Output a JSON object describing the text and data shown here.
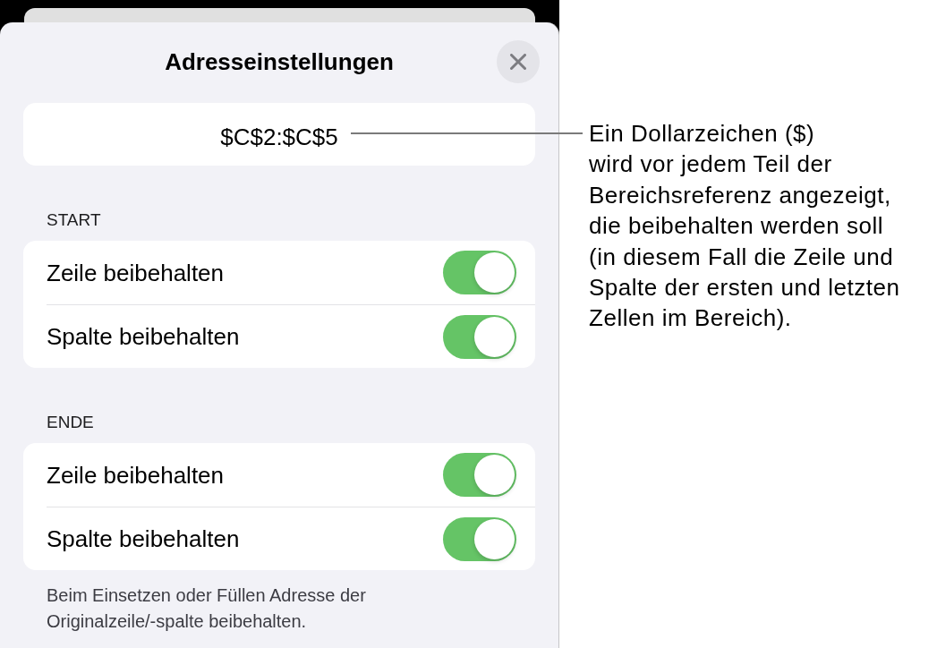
{
  "sheet": {
    "title": "Adresseinstellungen",
    "address_field": {
      "value": "$C$2:$C$5"
    },
    "sections": [
      {
        "header": "START",
        "toggles": [
          {
            "label": "Zeile beibehalten",
            "on": true
          },
          {
            "label": "Spalte beibehalten",
            "on": true
          }
        ]
      },
      {
        "header": "ENDE",
        "toggles": [
          {
            "label": "Zeile beibehalten",
            "on": true
          },
          {
            "label": "Spalte beibehalten",
            "on": true
          }
        ]
      }
    ],
    "footer": "Beim Einsetzen oder Füllen Adresse der\nOriginalzeile/-spalte beibehalten."
  },
  "callout": {
    "text": "Ein Dollarzeichen ($)\nwird vor jedem Teil der\nBereichsreferenz angezeigt,\ndie beibehalten werden soll\n(in diesem Fall die Zeile und\nSpalte der ersten und letzten\nZellen im Bereich)."
  }
}
